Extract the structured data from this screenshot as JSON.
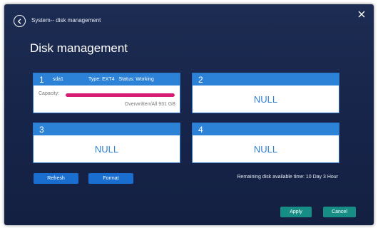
{
  "header": {
    "breadcrumb": "System-- disk management",
    "title": "Disk management"
  },
  "disks": [
    {
      "number": "1",
      "device": "sda1",
      "type": "Type: EXT4",
      "status": "Status: Working",
      "capacity_label": "Capacity:",
      "capacity_fraction": 1.0,
      "size_text": "Overwritten/All 931 GB"
    },
    {
      "number": "2",
      "null_text": "NULL"
    },
    {
      "number": "3",
      "null_text": "NULL"
    },
    {
      "number": "4",
      "null_text": "NULL"
    }
  ],
  "actions": {
    "refresh_label": "Refresh",
    "format_label": "Format",
    "apply_label": "Apply",
    "cancel_label": "Cancel"
  },
  "remaining_text": "Remaining disk available time: 10 Day 3 Hour",
  "colors": {
    "accent": "#2c82d6",
    "capacity_fill": "#d81b74",
    "button_blue": "#1a6ed0",
    "button_teal": "#168e86"
  }
}
